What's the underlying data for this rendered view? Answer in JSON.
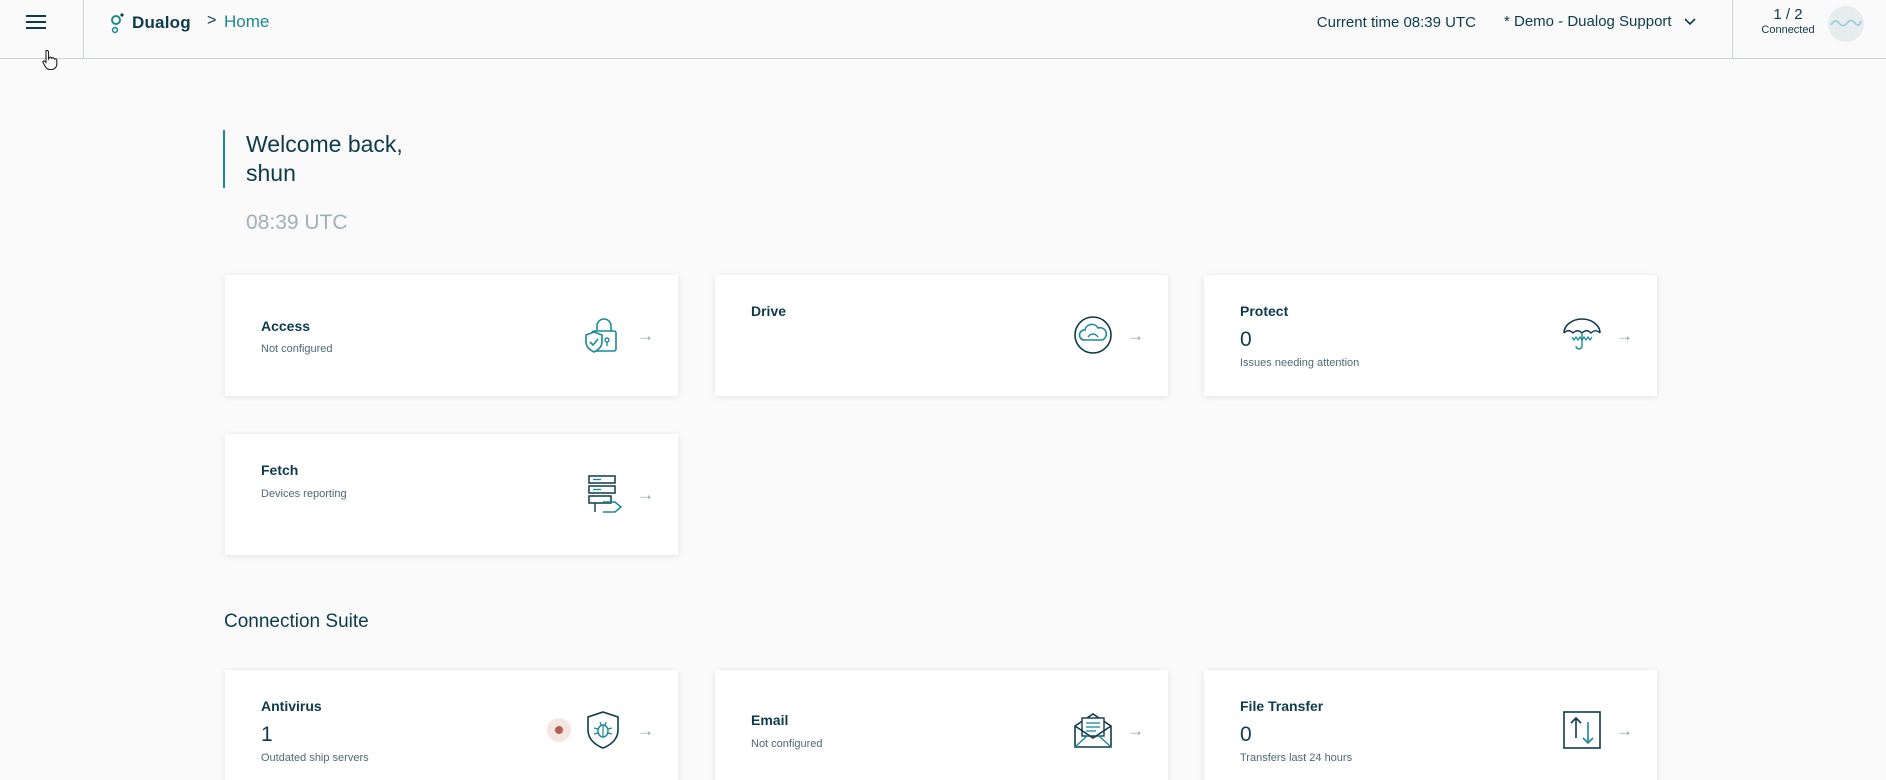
{
  "header": {
    "brand": "Dualog",
    "breadcrumb_separator": ">",
    "breadcrumb_current": "Home",
    "current_time": "Current time 08:39 UTC",
    "organization": "* Demo - Dualog Support",
    "connection_ratio": "1 / 2",
    "connection_label": "Connected",
    "icons": [
      "menu-icon",
      "dualog-logo-icon",
      "chevron-down-icon",
      "avatar-wave-icon"
    ]
  },
  "welcome": {
    "line1": "Welcome back,",
    "line2": "shun",
    "time": "08:39 UTC"
  },
  "cards": {
    "access": {
      "title": "Access",
      "sub": "Not configured",
      "icon": "lock-shield-icon"
    },
    "drive": {
      "title": "Drive",
      "icon": "cloud-circle-icon"
    },
    "protect": {
      "title": "Protect",
      "count": "0",
      "sub": "Issues needing attention",
      "icon": "umbrella-icon"
    },
    "fetch": {
      "title": "Fetch",
      "sub": "Devices reporting",
      "icon": "server-transfer-icon"
    }
  },
  "connection_suite": {
    "title": "Connection Suite",
    "antivirus": {
      "title": "Antivirus",
      "count": "1",
      "sub": "Outdated ship servers",
      "icon": "bug-shield-icon",
      "alert_color": "#b2604f"
    },
    "email": {
      "title": "Email",
      "sub": "Not configured",
      "icon": "envelope-icon"
    },
    "file_transfer": {
      "title": "File Transfer",
      "count": "0",
      "sub": "Transfers last 24 hours",
      "icon": "up-down-arrows-icon"
    }
  },
  "arrow": "→",
  "colors": {
    "accent": "#1a8a96",
    "text": "#0d3b4c",
    "muted": "#9fb1b8"
  }
}
